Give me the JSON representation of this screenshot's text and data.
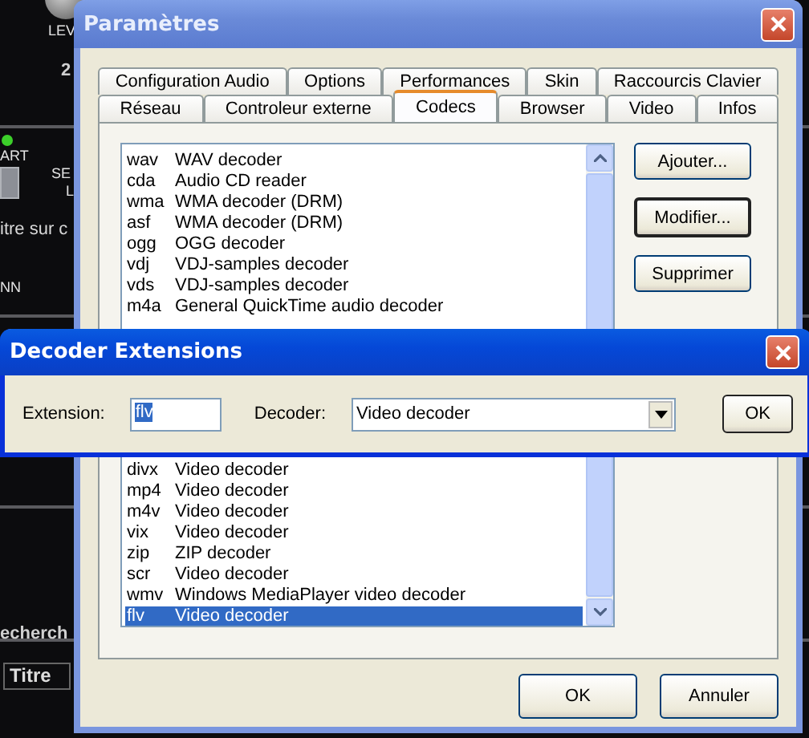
{
  "background_app": {
    "labels": [
      "LEV",
      "2",
      "ART",
      "SE",
      "L",
      "itre sur c",
      "NN",
      "echerch"
    ],
    "column_header": "Titre"
  },
  "settings_window": {
    "title": "Paramètres",
    "tab_rows": [
      [
        {
          "label": "Configuration Audio",
          "selected": false
        },
        {
          "label": "Options",
          "selected": false
        },
        {
          "label": "Performances",
          "selected": false
        },
        {
          "label": "Skin",
          "selected": false
        },
        {
          "label": "Raccourcis Clavier",
          "selected": false
        }
      ],
      [
        {
          "label": "Réseau",
          "selected": false
        },
        {
          "label": "Controleur externe",
          "selected": false
        },
        {
          "label": "Codecs",
          "selected": true
        },
        {
          "label": "Browser",
          "selected": false
        },
        {
          "label": "Video",
          "selected": false
        },
        {
          "label": "Infos",
          "selected": false
        }
      ]
    ],
    "codec_list": {
      "rows_top": [
        {
          "extension": "wav",
          "decoder": "WAV decoder",
          "selected": false
        },
        {
          "extension": "cda",
          "decoder": "Audio CD reader",
          "selected": false
        },
        {
          "extension": "wma",
          "decoder": "WMA decoder (DRM)",
          "selected": false
        },
        {
          "extension": "asf",
          "decoder": "WMA decoder (DRM)",
          "selected": false
        },
        {
          "extension": "ogg",
          "decoder": "OGG decoder",
          "selected": false
        },
        {
          "extension": "vdj",
          "decoder": "VDJ-samples decoder",
          "selected": false
        },
        {
          "extension": "vds",
          "decoder": "VDJ-samples decoder",
          "selected": false
        },
        {
          "extension": "m4a",
          "decoder": "General QuickTime audio decoder",
          "selected": false
        }
      ],
      "rows_bottom": [
        {
          "extension": "divx",
          "decoder": "Video decoder",
          "selected": false
        },
        {
          "extension": "mp4",
          "decoder": "Video decoder",
          "selected": false
        },
        {
          "extension": "m4v",
          "decoder": "Video decoder",
          "selected": false
        },
        {
          "extension": "vix",
          "decoder": "Video decoder",
          "selected": false
        },
        {
          "extension": "zip",
          "decoder": "ZIP decoder",
          "selected": false
        },
        {
          "extension": "scr",
          "decoder": "Video decoder",
          "selected": false
        },
        {
          "extension": "wmv",
          "decoder": "Windows MediaPlayer video decoder",
          "selected": false
        },
        {
          "extension": "flv",
          "decoder": "Video decoder",
          "selected": true
        }
      ]
    },
    "side_buttons": [
      {
        "label": "Ajouter...",
        "default": false
      },
      {
        "label": "Modifier...",
        "default": true
      },
      {
        "label": "Supprimer",
        "default": false
      }
    ],
    "buttons": [
      "OK",
      "Annuler"
    ]
  },
  "decoder_dialog": {
    "title": "Decoder Extensions",
    "extension_label": "Extension:",
    "extension_value": "flv",
    "decoder_label": "Decoder:",
    "decoder_value": "Video decoder",
    "ok_button": "OK"
  }
}
